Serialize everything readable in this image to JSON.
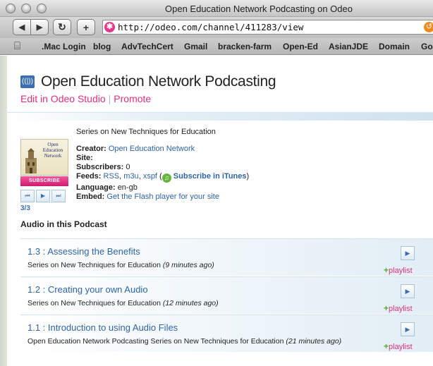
{
  "window": {
    "title": "Open Education Network Podcasting on Odeo"
  },
  "toolbar": {
    "back": "◀",
    "forward": "▶",
    "reload": "↻",
    "add": "+",
    "url": "http://odeo.com/channel/411283/view"
  },
  "bookmarks": [
    ".Mac Login",
    "blog",
    "AdvTechCert",
    "Gmail",
    "bracken-farm",
    "Open-Ed",
    "AsianJDE",
    "Domain",
    "Goo"
  ],
  "podcast": {
    "title": "Open Education Network Podcasting",
    "edit_link": "Edit in Odeo Studio",
    "separator": "|",
    "promote_link": "Promote",
    "cover_text": "Open Education Network",
    "subscribe_button": "SUBSCRIBE",
    "player": {
      "prev": "⏮",
      "play": "▶",
      "next": "⏭"
    },
    "track_count": "3/3",
    "description": "Series on New Techniques for Education",
    "meta": {
      "creator_label": "Creator:",
      "creator_value": "Open Education Network",
      "site_label": "Site:",
      "subscribers_label": "Subscribers:",
      "subscribers_value": "0",
      "feeds_label": "Feeds:",
      "feed_rss": "RSS",
      "feed_m3u": "m3u",
      "feed_xspf": "xspf",
      "itunes_link": "Subscribe in iTunes",
      "language_label": "Language:",
      "language_value": "en-gb",
      "embed_label": "Embed:",
      "embed_link": "Get the Flash player for your site"
    }
  },
  "audio_heading": "Audio in this Podcast",
  "episodes": [
    {
      "title": "1.3 : Assessing the Benefits",
      "series": "Series on New Techniques for Education",
      "ago": "(9 minutes ago)",
      "playlist": "playlist"
    },
    {
      "title": "1.2 : Creating your own Audio",
      "series": "Series on New Techniques for Education",
      "ago": "(12 minutes ago)",
      "playlist": "playlist"
    },
    {
      "title": "1.1 : Introduction to using Audio Files",
      "series": "Open Education Network Podcasting Series on New Techniques for Education",
      "ago": "(21 minutes ago)",
      "playlist": "playlist"
    }
  ],
  "colors": {
    "pink": "#e0307d",
    "link_blue": "#2d64a6",
    "accent_blue": "#3b6fb0"
  }
}
